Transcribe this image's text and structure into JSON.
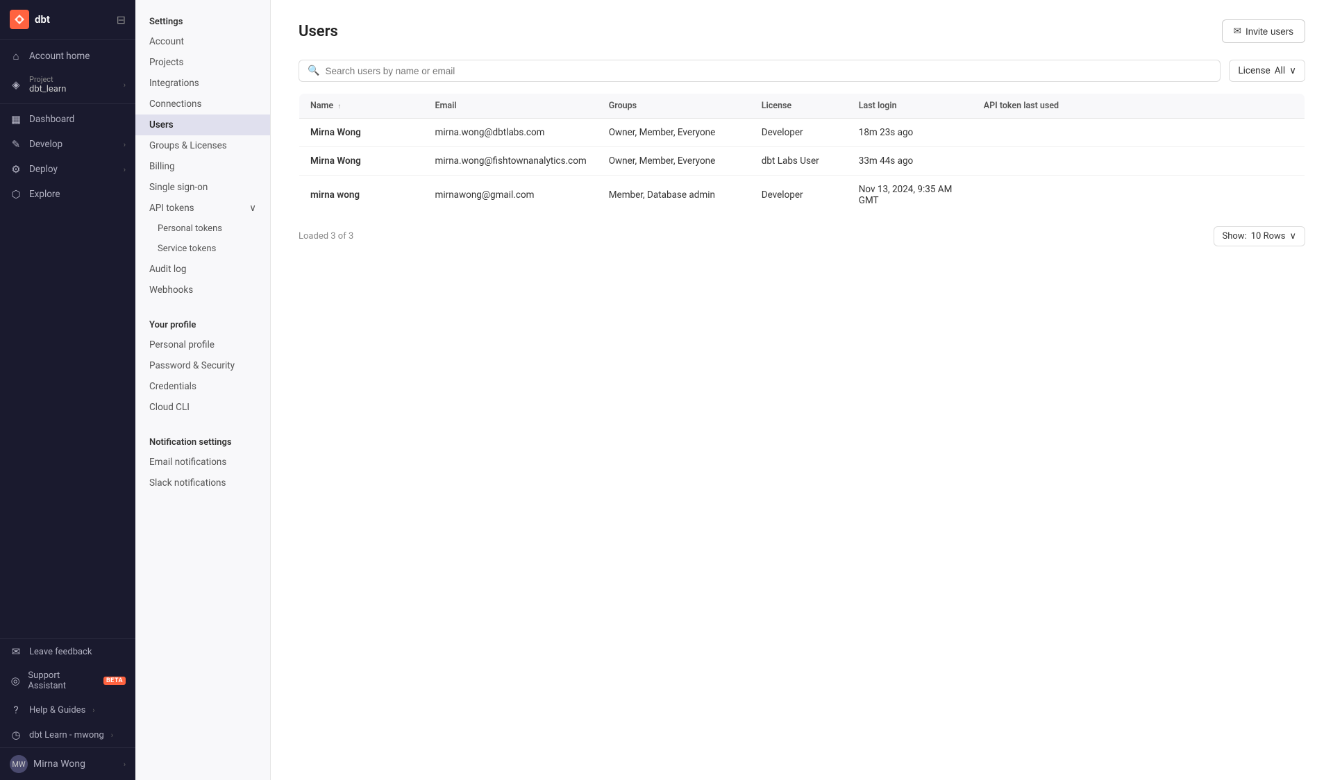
{
  "app": {
    "logo_text": "dbt",
    "logo_abbr": "X"
  },
  "left_nav": {
    "account_home": "Account home",
    "project_label": "Project",
    "project_name": "dbt_learn",
    "dashboard": "Dashboard",
    "develop": "Develop",
    "deploy": "Deploy",
    "explore": "Explore",
    "leave_feedback": "Leave feedback",
    "support_assistant": "Support Assistant",
    "beta_badge": "BETA",
    "help_guides": "Help & Guides",
    "dbt_learn": "dbt Learn - mwong",
    "user_name": "Mirna Wong",
    "collapse_icon": "⊟"
  },
  "sidebar": {
    "settings_heading": "Settings",
    "items": [
      {
        "id": "account",
        "label": "Account"
      },
      {
        "id": "projects",
        "label": "Projects"
      },
      {
        "id": "integrations",
        "label": "Integrations"
      },
      {
        "id": "connections",
        "label": "Connections"
      },
      {
        "id": "users",
        "label": "Users",
        "active": true
      },
      {
        "id": "groups-licenses",
        "label": "Groups & Licenses"
      },
      {
        "id": "billing",
        "label": "Billing"
      },
      {
        "id": "single-sign-on",
        "label": "Single sign-on"
      },
      {
        "id": "api-tokens",
        "label": "API tokens"
      },
      {
        "id": "personal-tokens",
        "label": "Personal tokens",
        "sub": true
      },
      {
        "id": "service-tokens",
        "label": "Service tokens",
        "sub": true
      },
      {
        "id": "audit-log",
        "label": "Audit log"
      },
      {
        "id": "webhooks",
        "label": "Webhooks"
      }
    ],
    "profile_heading": "Your profile",
    "profile_items": [
      {
        "id": "personal-profile",
        "label": "Personal profile"
      },
      {
        "id": "password-security",
        "label": "Password & Security"
      },
      {
        "id": "credentials",
        "label": "Credentials"
      },
      {
        "id": "cloud-cli",
        "label": "Cloud CLI"
      }
    ],
    "notification_heading": "Notification settings",
    "notification_items": [
      {
        "id": "email-notifications",
        "label": "Email notifications"
      },
      {
        "id": "slack-notifications",
        "label": "Slack notifications"
      }
    ]
  },
  "main": {
    "page_title": "Users",
    "invite_btn": "Invite users",
    "search_placeholder": "Search users by name or email",
    "license_filter_label": "License",
    "license_filter_value": "All",
    "table_headers": {
      "name": "Name",
      "email": "Email",
      "groups": "Groups",
      "license": "License",
      "last_login": "Last login",
      "api_token": "API token last used"
    },
    "users": [
      {
        "name": "Mirna Wong",
        "email": "mirna.wong@dbtlabs.com",
        "groups": "Owner, Member, Everyone",
        "license": "Developer",
        "last_login": "18m 23s ago",
        "api_token": ""
      },
      {
        "name": "Mirna Wong",
        "email": "mirna.wong@fishtownanalytics.com",
        "groups": "Owner, Member, Everyone",
        "license": "dbt Labs User",
        "last_login": "33m 44s ago",
        "api_token": ""
      },
      {
        "name": "mirna wong",
        "email": "mirnawong@gmail.com",
        "groups": "Member, Database admin",
        "license": "Developer",
        "last_login": "Nov 13, 2024, 9:35 AM GMT",
        "api_token": ""
      }
    ],
    "loaded_text": "Loaded 3 of 3",
    "show_rows_label": "Show:",
    "show_rows_value": "10 Rows"
  }
}
